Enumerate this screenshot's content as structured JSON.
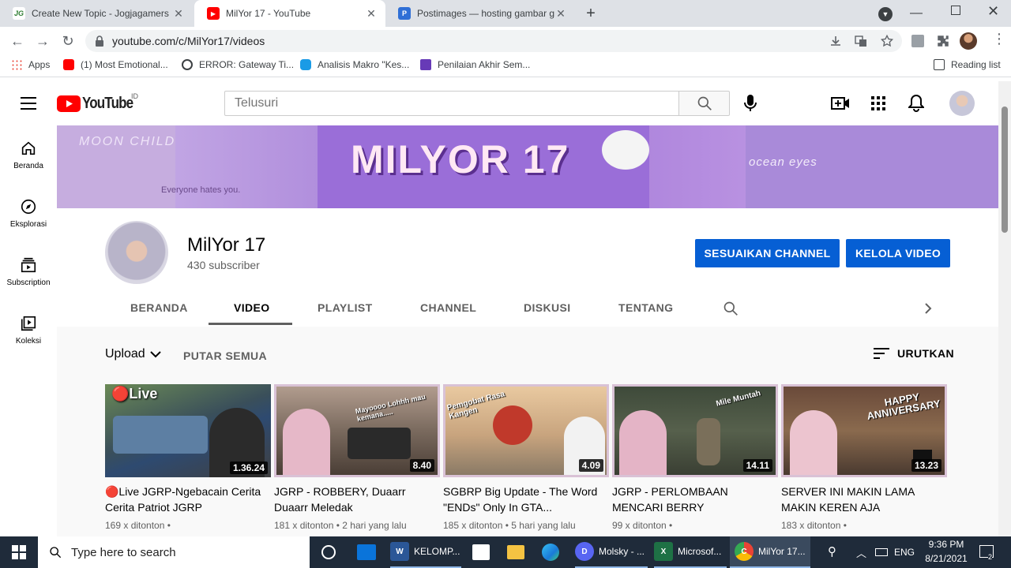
{
  "browser": {
    "tabs": [
      {
        "title": "Create New Topic - Jogjagamers",
        "favicon_text": "JG"
      },
      {
        "title": "MilYor 17 - YouTube",
        "favicon_text": "▶"
      },
      {
        "title": "Postimages — hosting gambar g",
        "favicon_text": "P"
      }
    ],
    "url": "youtube.com/c/MilYor17/videos",
    "bookmarks": [
      "Apps",
      "(1) Most Emotional...",
      "ERROR: Gateway Ti...",
      "Analisis Makro \"Kes...",
      "Penilaian Akhir Sem..."
    ],
    "reading_list": "Reading list"
  },
  "youtube": {
    "logo_text": "YouTube",
    "region": "ID",
    "search_placeholder": "Telusuri",
    "sidebar": [
      {
        "label": "Beranda",
        "icon": "home-icon"
      },
      {
        "label": "Eksplorasi",
        "icon": "compass-icon"
      },
      {
        "label": "Subscription",
        "icon": "subscriptions-icon"
      },
      {
        "label": "Koleksi",
        "icon": "library-icon"
      }
    ],
    "banner": {
      "text": "MILYOR 17",
      "deco_left": "MOON CHILD",
      "deco_left2": "Everyone hates you.",
      "deco_right": "ocean eyes"
    },
    "channel": {
      "name": "MilYor 17",
      "subscribers": "430 subscriber",
      "customize_label": "SESUAIKAN CHANNEL",
      "manage_label": "KELOLA VIDEO"
    },
    "tabs": [
      "BERANDA",
      "VIDEO",
      "PLAYLIST",
      "CHANNEL",
      "DISKUSI",
      "TENTANG"
    ],
    "selected_tab": "VIDEO",
    "filter": {
      "upload_label": "Upload",
      "play_all": "PUTAR SEMUA",
      "sort_label": "URUTKAN"
    },
    "videos": [
      {
        "title": "🔴Live JGRP-Ngebacain Cerita Cerita Patriot JGRP",
        "duration": "1.36.24",
        "meta": "169 x ditonton •",
        "thumb_text": "🔴Live"
      },
      {
        "title": "JGRP - ROBBERY, Duaarr Duaarr Meledak",
        "duration": "8.40",
        "meta": "181 x ditonton • 2 hari yang lalu",
        "thumb_text": "Mayoooo Lohhh mau kemana....."
      },
      {
        "title": "SGBRP Big Update - The Word \"ENDs\" Only In GTA...",
        "duration": "4.09",
        "meta": "185 x ditonton • 5 hari yang lalu",
        "thumb_text": "Pemgobat Rasa Kangen"
      },
      {
        "title": "JGRP - PERLOMBAAN MENCARI BERRY",
        "duration": "14.11",
        "meta": "99 x ditonton •",
        "thumb_text": "Mile Muntah"
      },
      {
        "title": "SERVER INI MAKIN LAMA MAKIN KEREN AJA",
        "duration": "13.23",
        "meta": "183 x ditonton •",
        "thumb_text": "HAPPY ANNIVERSARY"
      }
    ]
  },
  "taskbar": {
    "search_placeholder": "Type here to search",
    "apps": [
      {
        "label": "KELOMP...",
        "icon_text": "W",
        "color": "#2b5797"
      },
      {
        "label": "Molsky - ...",
        "icon_text": "D",
        "color": "#5865f2"
      },
      {
        "label": "Microsof...",
        "icon_text": "X",
        "color": "#1e7145"
      },
      {
        "label": "MilYor 17...",
        "icon_text": "C",
        "color": "#4285f4"
      }
    ],
    "lang": "ENG",
    "time": "9:36 PM",
    "date": "8/21/2021",
    "notif_count": "2"
  },
  "colors": {
    "yt_red": "#ff0000",
    "blue_button": "#065fd4"
  }
}
